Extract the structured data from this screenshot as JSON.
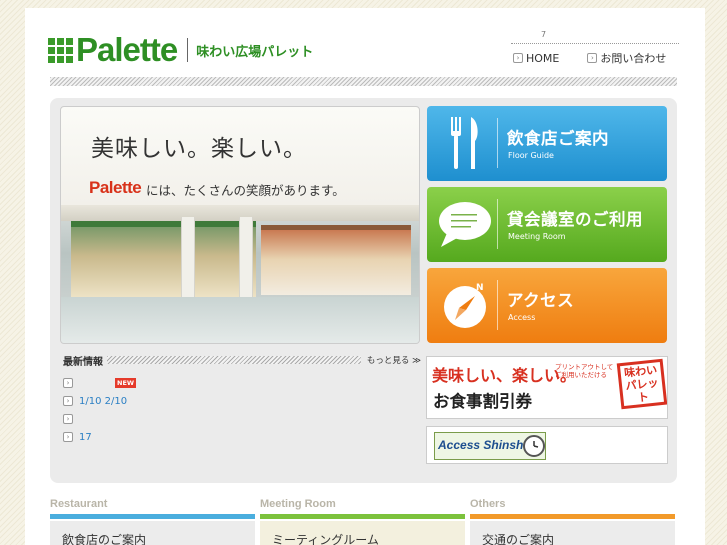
{
  "header": {
    "logo_text": "Palette",
    "logo_subtitle": "味わい広場パレット",
    "counter": "7",
    "nav": [
      {
        "label": "HOME",
        "icon": "arrow-right-icon"
      },
      {
        "label": "お問い合わせ",
        "icon": "arrow-right-icon"
      }
    ]
  },
  "hero": {
    "title": "美味しい。楽しい。",
    "logo": "Palette",
    "subtitle": "には、たくさんの笑顔があります。"
  },
  "tiles": [
    {
      "main": "飲食店ご案内",
      "sub": "Floor Guide",
      "icon": "fork-knife-icon",
      "color": "#1e8fcf"
    },
    {
      "main": "貸会議室のご利用",
      "sub": "Meeting Room",
      "icon": "speech-bubble-icon",
      "color": "#55a91e"
    },
    {
      "main": "アクセス",
      "sub": "Access",
      "icon": "compass-icon",
      "color": "#ef7d10"
    }
  ],
  "news": {
    "title": "最新情報",
    "more": "もっと見る ≫",
    "new_badge": "NEW",
    "items": [
      {
        "text": ""
      },
      {
        "text": "1/10 2/10"
      },
      {
        "text": ""
      },
      {
        "text": "17"
      }
    ]
  },
  "banner_coupon": {
    "title": "美味しい、楽しい。",
    "small_line1": "プリントアウトして",
    "small_line2": "ご利用いただける",
    "main": "お食事割引券",
    "seal": "味わい広場パレット"
  },
  "banner_access": {
    "title": "Access Shinshu"
  },
  "bottom": [
    {
      "en": "Restaurant",
      "jp": "飲食店のご案内"
    },
    {
      "en": "Meeting Room",
      "jp": "ミーティングルーム"
    },
    {
      "en": "Others",
      "jp": "交通のご案内"
    }
  ]
}
